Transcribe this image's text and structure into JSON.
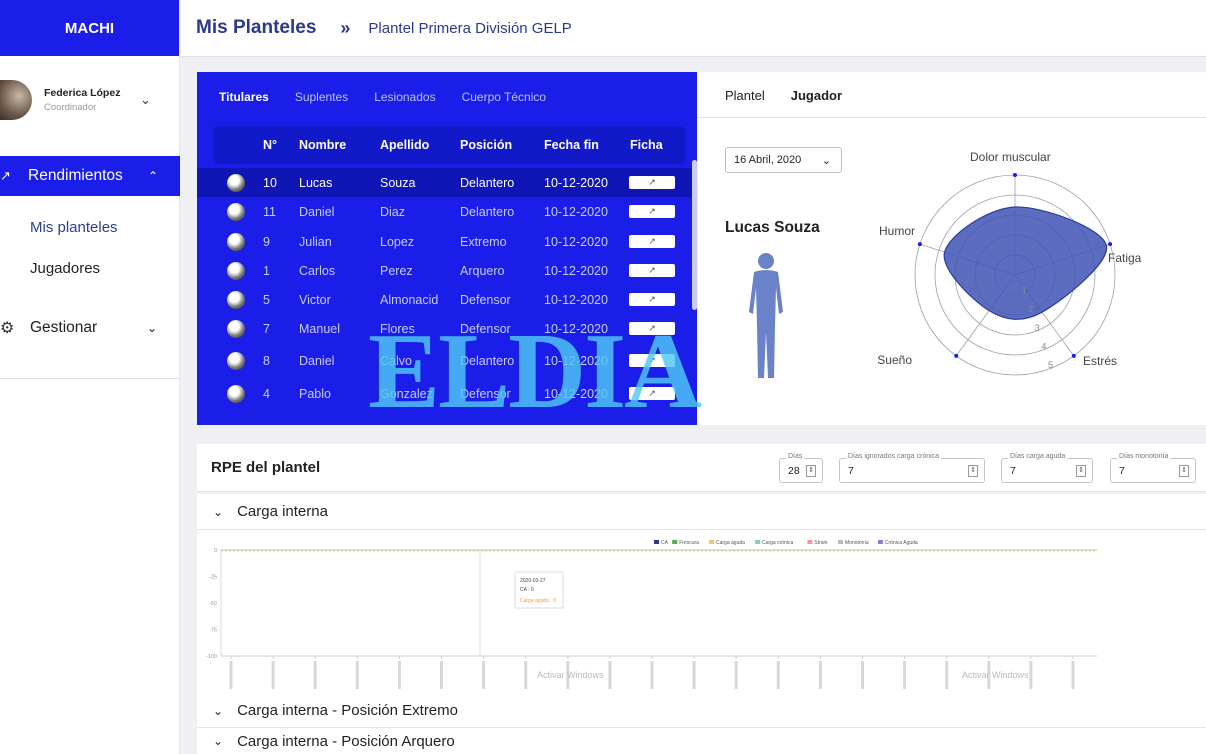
{
  "brand": "MACHI",
  "user": {
    "name": "Federica López",
    "role": "Coordinador"
  },
  "nav": {
    "rendimientos": "Rendimientos",
    "mis_planteles": "Mis planteles",
    "jugadores": "Jugadores",
    "gestionar": "Gestionar"
  },
  "breadcrumb": {
    "main": "Mis Planteles",
    "separator": "»",
    "current": "Plantel Primera División GELP"
  },
  "table_tabs": [
    "Titulares",
    "Suplentes",
    "Lesionados",
    "Cuerpo Técnico"
  ],
  "table": {
    "headers": [
      "N°",
      "Nombre",
      "Apellido",
      "Posición",
      "Fecha fin",
      "Ficha"
    ],
    "rows": [
      {
        "num": "10",
        "nombre": "Lucas",
        "apellido": "Souza",
        "posicion": "Delantero",
        "fecha": "10-12-2020",
        "selected": true
      },
      {
        "num": "11",
        "nombre": "Daniel",
        "apellido": "Diaz",
        "posicion": "Delantero",
        "fecha": "10-12-2020"
      },
      {
        "num": "9",
        "nombre": "Julian",
        "apellido": "Lopez",
        "posicion": "Extremo",
        "fecha": "10-12-2020"
      },
      {
        "num": "1",
        "nombre": "Carlos",
        "apellido": "Perez",
        "posicion": "Arquero",
        "fecha": "10-12-2020"
      },
      {
        "num": "5",
        "nombre": "Victor",
        "apellido": "Almonacid",
        "posicion": "Defensor",
        "fecha": "10-12-2020"
      },
      {
        "num": "7",
        "nombre": "Manuel",
        "apellido": "Flores",
        "posicion": "Defensor",
        "fecha": "10-12-2020"
      },
      {
        "num": "8",
        "nombre": "Daniel",
        "apellido": "Calvo",
        "posicion": "Delantero",
        "fecha": "10-12-2020"
      },
      {
        "num": "4",
        "nombre": "Pablo",
        "apellido": "Gonzalez",
        "posicion": "Defensor",
        "fecha": "10-12-2020"
      }
    ]
  },
  "right_tabs": [
    "Plantel",
    "Jugador"
  ],
  "date": "16 Abril, 2020",
  "player_name": "Lucas Souza",
  "radar": {
    "axes": [
      "Dolor muscular",
      "Fatiga",
      "Estrés",
      "Sueño",
      "Humor"
    ],
    "values": [
      3.4,
      4.8,
      2.3,
      2.2,
      3.7
    ],
    "rings": [
      "1",
      "2",
      "3",
      "4",
      "5"
    ],
    "max": 5
  },
  "watermark": "ELDIA",
  "rpe": {
    "title": "RPE del plantel",
    "fields": [
      {
        "label": "Días",
        "value": "28"
      },
      {
        "label": "Días ignorados carga crónica",
        "value": "7"
      },
      {
        "label": "Días carga aguda",
        "value": "7"
      },
      {
        "label": "Días monotonía",
        "value": "7"
      }
    ]
  },
  "accordions": [
    "Carga interna",
    "Carga interna - Posición Extremo",
    "Carga interna - Posición Arquero"
  ],
  "chart_data": {
    "type": "line",
    "legend": [
      "CA",
      "Frescura",
      "Carga aguda",
      "Carga crónica",
      "Strain",
      "Monotonía",
      "Crónica Aguda"
    ],
    "y_ticks": [
      "0",
      "-25",
      "-50",
      "-75",
      "-100"
    ],
    "tooltip": {
      "date": "2020-03-27",
      "line1": "CA : 0",
      "line2": "Carga aguda : 0"
    },
    "windows_notice": "Activar Windows"
  },
  "colors": {
    "primary": "#1a1ee8",
    "title": "#2b3a8c",
    "radar_fill": "#3f53b5",
    "watermark": "#50c8f5"
  }
}
